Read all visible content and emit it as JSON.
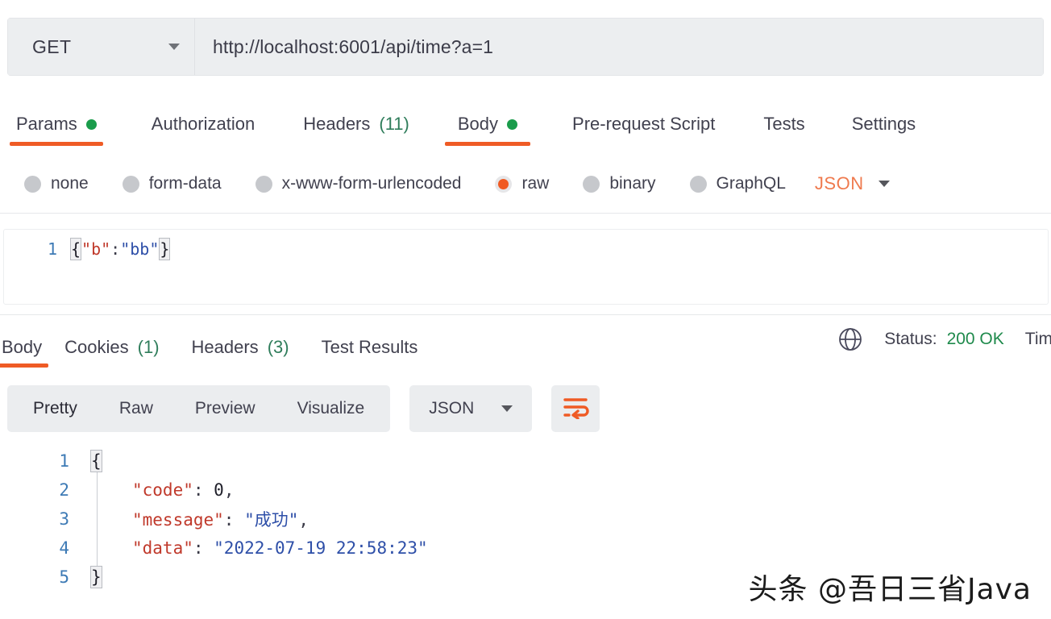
{
  "request": {
    "method": "GET",
    "url": "http://localhost:6001/api/time?a=1",
    "tabs": [
      {
        "label": "Params",
        "indicator": "dot",
        "count": "",
        "active": false
      },
      {
        "label": "Authorization",
        "indicator": "",
        "count": "",
        "active": false
      },
      {
        "label": "Headers",
        "indicator": "",
        "count": "(11)",
        "active": false
      },
      {
        "label": "Body",
        "indicator": "dot",
        "count": "",
        "active": true
      },
      {
        "label": "Pre-request Script",
        "indicator": "",
        "count": "",
        "active": false
      },
      {
        "label": "Tests",
        "indicator": "",
        "count": "",
        "active": false
      },
      {
        "label": "Settings",
        "indicator": "",
        "count": "",
        "active": false
      }
    ],
    "body_types": [
      {
        "label": "none",
        "selected": false
      },
      {
        "label": "form-data",
        "selected": false
      },
      {
        "label": "x-www-form-urlencoded",
        "selected": false
      },
      {
        "label": "raw",
        "selected": true
      },
      {
        "label": "binary",
        "selected": false
      },
      {
        "label": "GraphQL",
        "selected": false
      }
    ],
    "raw_format": "JSON",
    "body_editor": {
      "line_number": "1",
      "open_brace": "{",
      "key": "\"b\"",
      "colon": ":",
      "value": "\"bb\"",
      "close_brace": "}"
    }
  },
  "response": {
    "tabs": [
      {
        "label": "Body",
        "count": "",
        "active": true
      },
      {
        "label": "Cookies",
        "count": "(1)",
        "active": false
      },
      {
        "label": "Headers",
        "count": "(3)",
        "active": false
      },
      {
        "label": "Test Results",
        "count": "",
        "active": false
      }
    ],
    "status_label": "Status:",
    "status_value": "200 OK",
    "time_label": "Tim",
    "view_modes": [
      {
        "label": "Pretty",
        "active": true
      },
      {
        "label": "Raw",
        "active": false
      },
      {
        "label": "Preview",
        "active": false
      },
      {
        "label": "Visualize",
        "active": false
      }
    ],
    "format": "JSON",
    "wrap_icon": "word-wrap-icon",
    "globe_icon": "globe-icon",
    "body_lines": [
      {
        "n": "1",
        "indent": false,
        "text": "{",
        "brace": true
      },
      {
        "n": "2",
        "indent": true,
        "key": "\"code\"",
        "sep": ": ",
        "value": "0",
        "value_type": "number",
        "tail": ","
      },
      {
        "n": "3",
        "indent": true,
        "key": "\"message\"",
        "sep": ": ",
        "value": "\"成功\"",
        "value_type": "string",
        "tail": ","
      },
      {
        "n": "4",
        "indent": true,
        "key": "\"data\"",
        "sep": ": ",
        "value": "\"2022-07-19 22:58:23\"",
        "value_type": "string",
        "tail": ""
      },
      {
        "n": "5",
        "indent": false,
        "text": "}",
        "brace": true
      }
    ]
  },
  "watermark": "头条 @吾日三省Java",
  "colors": {
    "accent_orange": "#ef5b25",
    "status_green": "#1f8a4c",
    "indicator_green": "#1a9c4b",
    "json_orange": "#ef7a4e",
    "gutter_blue": "#3d7ab5",
    "key_red": "#c0392b",
    "string_blue": "#2e4fa8"
  }
}
